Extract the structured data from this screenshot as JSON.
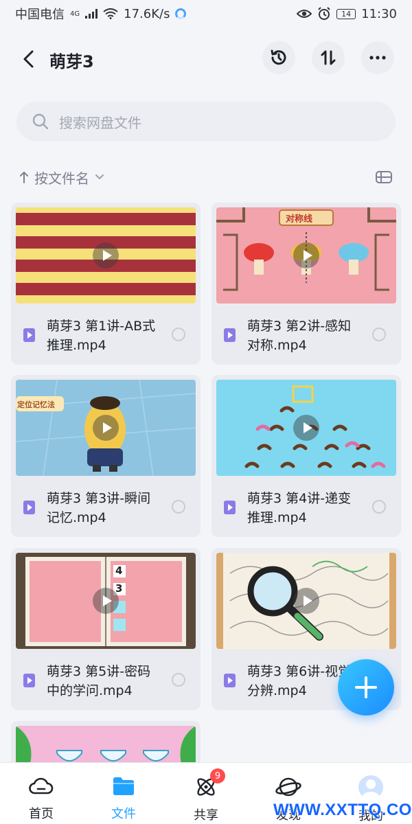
{
  "status_bar": {
    "carrier": "中国电信",
    "network": "4G",
    "speed": "17.6K/s",
    "battery": "14",
    "time": "11:30"
  },
  "header": {
    "title": "萌芽3",
    "icons": [
      "back-arrow-icon",
      "history-icon",
      "sort-icon",
      "more-icon"
    ]
  },
  "search": {
    "placeholder": "搜索网盘文件"
  },
  "sort": {
    "label": "按文件名"
  },
  "files": [
    {
      "name": "萌芽3 第1讲-AB式推理.mp4"
    },
    {
      "name": "萌芽3 第2讲-感知对称.mp4",
      "thumb_text": "对称线"
    },
    {
      "name": "萌芽3 第3讲-瞬间记忆.mp4",
      "thumb_text": "定位记忆法"
    },
    {
      "name": "萌芽3 第4讲-递变推理.mp4"
    },
    {
      "name": "萌芽3 第5讲-密码中的学问.mp4",
      "thumb_numbers": [
        "4",
        "3"
      ]
    },
    {
      "name": "萌芽3 第6讲-视觉分辨.mp4"
    },
    {
      "name": ""
    }
  ],
  "nav": {
    "items": [
      {
        "label": "首页",
        "icon": "cloud-icon"
      },
      {
        "label": "文件",
        "icon": "folder-icon"
      },
      {
        "label": "共享",
        "icon": "atom-icon",
        "badge": "9"
      },
      {
        "label": "发现",
        "icon": "planet-icon"
      },
      {
        "label": "我的",
        "icon": "avatar-icon"
      }
    ]
  },
  "watermark": "WWW.XXTTQ.COM",
  "colors": {
    "accent": "#22a2ff",
    "badge": "#ff4d4f",
    "file_icon": "#8c7ae6"
  }
}
